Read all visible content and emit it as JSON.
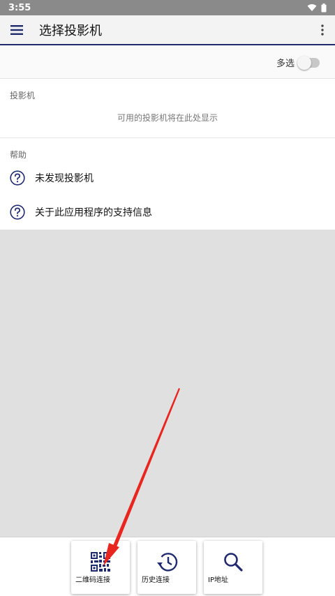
{
  "status_bar": {
    "time": "3:55"
  },
  "app_bar": {
    "title": "选择投影机"
  },
  "multi_select": {
    "label": "多选",
    "enabled": false
  },
  "projectors": {
    "header": "投影机",
    "empty_text": "可用的投影机将在此处显示"
  },
  "help": {
    "header": "帮助",
    "items": [
      {
        "label": "未发现投影机",
        "icon": "question-circle-icon"
      },
      {
        "label": "关于此应用程序的支持信息",
        "icon": "question-circle-icon"
      }
    ]
  },
  "bottom_buttons": [
    {
      "label": "二维码连接",
      "icon": "qr-code-icon"
    },
    {
      "label": "历史连接",
      "icon": "history-icon"
    },
    {
      "label": "IP地址",
      "icon": "search-icon"
    }
  ],
  "colors": {
    "accent": "#1f2a6e",
    "arrow": "#e8261f",
    "content_bg": "#e0e0e0"
  }
}
